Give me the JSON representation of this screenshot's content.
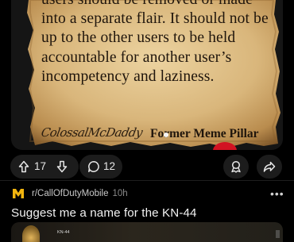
{
  "post_image": {
    "lines": [
      "users should be removed or made",
      "into a separate flair. It should not be",
      "up to the other users to be held",
      "accountable for another user’s",
      "incompetency and laziness."
    ],
    "signature": "ColossalMcDaddy",
    "signature_title": "Former Meme Pillar"
  },
  "actions": {
    "vote_count": "17",
    "comment_count": "12"
  },
  "next_post": {
    "subreddit": "r/CallOfDutyMobile",
    "time": "10h",
    "title": "Suggest me a name for the KN-44",
    "thumbnail_label": "KN-44"
  },
  "icons": {
    "upvote": "arrow-up-outline",
    "downvote": "arrow-down-outline",
    "comment": "speech-bubble",
    "award": "award-ribbon",
    "share": "share-arrow",
    "more": "ellipsis"
  },
  "colors": {
    "background": "#000000",
    "pill": "#1c1c1c",
    "parchment": "#dcc08a",
    "seal": "#d21322",
    "subreddit_icon": "#f2b50f"
  }
}
